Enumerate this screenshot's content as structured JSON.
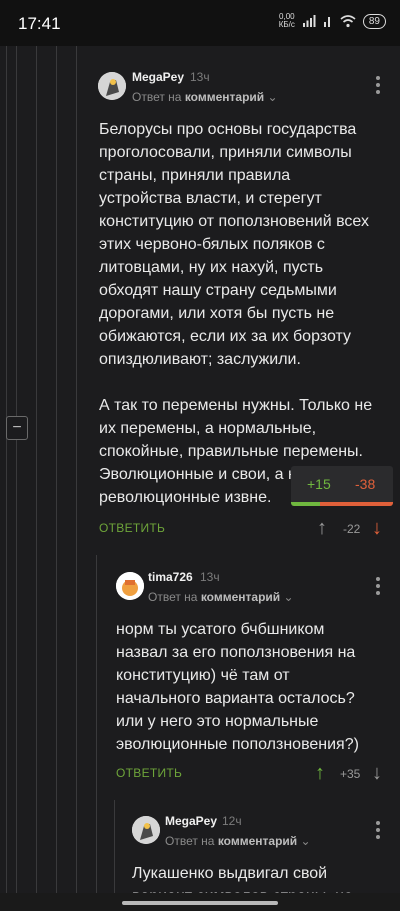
{
  "status_bar": {
    "time": "17:41",
    "net_speed": "0,00",
    "net_unit": "КБ/с",
    "battery": "89"
  },
  "comments": [
    {
      "author": "MegaPey",
      "time": "13ч",
      "reply_prefix": "Ответ на",
      "reply_target": "комментарий",
      "text": "Белорусы про основы государства проголосовали, приняли символы страны, приняли правила устройства власти, и стерегут конституцию от поползновений всех этих червоно-бялых поляков с литовцами, ну их нахуй, пусть обходят нашу страну седьмыми дорогами, или хотя бы пусть не обижаются, если их за их борзоту опиздюливают; заслужили.\n\nА так то перемены нужны. Только не их перемены, а нормальные, спокойные, правильные перемены. Эволюционные и свои, а не революционные извне.",
      "reply_label": "ОТВЕТИТЬ",
      "rating": "-22",
      "vote_popup": {
        "plus": "+15",
        "minus": "-38",
        "plus_share": 0.28
      }
    },
    {
      "author": "tima726",
      "time": "13ч",
      "reply_prefix": "Ответ на",
      "reply_target": "комментарий",
      "text": "норм ты усатого бчбшником назвал за его поползновения на конституцию) чё там от начального варианта осталось? или у него это нормальные эволюционные поползновения?)",
      "reply_label": "ОТВЕТИТЬ",
      "rating": "+35"
    },
    {
      "author": "MegaPey",
      "time": "12ч",
      "reply_prefix": "Ответ на",
      "reply_target": "комментарий",
      "text": "Лукашенко выдвигал свой вариант символов страны, не"
    }
  ],
  "colors": {
    "upvote": "#70b83f",
    "downvote": "#e0603a",
    "reply": "#6ea53a"
  }
}
